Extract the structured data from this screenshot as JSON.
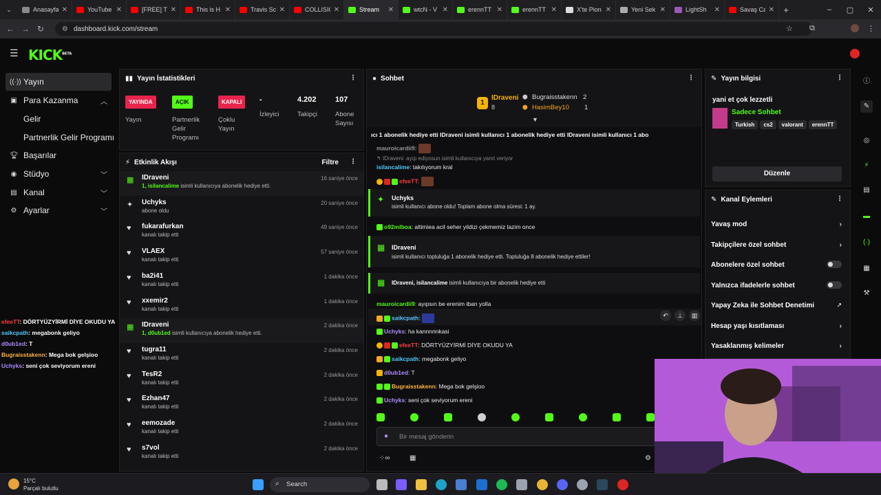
{
  "browser": {
    "tabs": [
      {
        "label": "Anasayfa",
        "color": "#888888"
      },
      {
        "label": "YouTube",
        "color": "#ff0000"
      },
      {
        "label": "[FREE] TRAVIS",
        "color": "#ff0000"
      },
      {
        "label": "This is H",
        "color": "#ff0000"
      },
      {
        "label": "Travis Sc",
        "color": "#ff0000"
      },
      {
        "label": "COLLISION",
        "color": "#ff0000"
      },
      {
        "label": "Stream",
        "color": "#53fc18"
      },
      {
        "label": "wtcN - V",
        "color": "#53fc18"
      },
      {
        "label": "erennTT",
        "color": "#53fc18"
      },
      {
        "label": "erennTT",
        "color": "#53fc18"
      },
      {
        "label": "X'te Pion",
        "color": "#dddddd"
      },
      {
        "label": "Yeni Sek",
        "color": "#aaaaaa"
      },
      {
        "label": "LightSh",
        "color": "#9b59b6"
      },
      {
        "label": "Savaş Ca",
        "color": "#ff0000"
      }
    ],
    "url": "dashboard.kick.com/stream"
  },
  "brand": {
    "logo": "KICK",
    "beta": "BETA",
    "accent": "#53fc18"
  },
  "nav": {
    "yayin": "Yayın",
    "para": "Para Kazanma",
    "gelir": "Gelir",
    "partner": "Partnerlik Gelir Programı",
    "basarilar": "Başarılar",
    "studyo": "Stüdyo",
    "kanal": "Kanal",
    "ayarlar": "Ayarlar"
  },
  "overlay_chat": [
    {
      "user": "efeeTT",
      "text": ": DÖRTYÜZYİRMİ DİYE OKUDU YA",
      "color": "#ff3b3b"
    },
    {
      "user": "saikcpath",
      "text": ": megabonk geliyo",
      "color": "#53c8ff"
    },
    {
      "user": "d0ub1ed",
      "text": ": T",
      "color": "#b18cff"
    },
    {
      "user": "Bugraisstakenn",
      "text": ": Mega bok gelşioo",
      "color": "#ffb340"
    },
    {
      "user": "Uchyks",
      "text": ": seni çok seviyorum ereni",
      "color": "#b18cff"
    }
  ],
  "stats": {
    "title": "Yayın İstatistikleri",
    "yayin_badge": "YAYINDA",
    "yayin_label": "Yayın",
    "partner_badge": "AÇIK",
    "partner_label": "Partnerlik Gelir Programı",
    "coklu_badge": "KAPALI",
    "coklu_label": "Çoklu Yayın",
    "izleyici_val": "-",
    "izleyici_label": "İzleyici",
    "takipci_val": "4.202",
    "takipci_label": "Takipçi",
    "abone_val": "107",
    "abone_label": "Abone Sayısı"
  },
  "activity": {
    "title": "Etkinlik Akışı",
    "filter": "Filtre",
    "items": [
      {
        "name": "IDraveni",
        "desc_hl": "1, isilancalime",
        "desc": " isimli kullanıcıya abonelik hediye etti.",
        "time": "16 saniye önce",
        "icon": "gift"
      },
      {
        "name": "Uchyks",
        "desc_hl": "",
        "desc": "abone oldu",
        "time": "20 saniye önce",
        "icon": "star"
      },
      {
        "name": "fukarafurkan",
        "desc_hl": "",
        "desc": "kanalı takip etti",
        "time": "49 saniye önce",
        "icon": "heart"
      },
      {
        "name": "VLAEX",
        "desc_hl": "",
        "desc": "kanalı takip etti",
        "time": "57 saniye önce",
        "icon": "heart"
      },
      {
        "name": "ba2i41",
        "desc_hl": "",
        "desc": "kanalı takip etti",
        "time": "1 dakika önce",
        "icon": "heart"
      },
      {
        "name": "xxemir2",
        "desc_hl": "",
        "desc": "kanalı takip etti",
        "time": "1 dakika önce",
        "icon": "heart"
      },
      {
        "name": "IDraveni",
        "desc_hl": "1, d0ub1ed",
        "desc": " isimli kullanıcıya abonelik hediye etti.",
        "time": "2 dakika önce",
        "icon": "gift"
      },
      {
        "name": "tugra11",
        "desc_hl": "",
        "desc": "kanalı takip etti",
        "time": "2 dakika önce",
        "icon": "heart"
      },
      {
        "name": "TesR2",
        "desc_hl": "",
        "desc": "kanalı takip etti",
        "time": "2 dakika önce",
        "icon": "heart"
      },
      {
        "name": "Ezhan47",
        "desc_hl": "",
        "desc": "kanalı takip etti",
        "time": "2 dakika önce",
        "icon": "heart"
      },
      {
        "name": "eemozade",
        "desc_hl": "",
        "desc": "kanalı takip etti",
        "time": "2 dakika önce",
        "icon": "heart"
      },
      {
        "name": "s7vol",
        "desc_hl": "",
        "desc": "kanalı takip etti",
        "time": "2 dakika önce",
        "icon": "heart"
      }
    ]
  },
  "chat": {
    "title": "Sohbet",
    "leader_rank": "1",
    "leader_name": "IDraveni",
    "leader_count": "8",
    "top2_name": "Bugraisstakenn",
    "top2_count": "2",
    "top3_name": "HasimBey10",
    "top3_count": "1",
    "ticker": "ıcı 1 abonelik hediye etti   IDraveni isimli kullanıcı 1 abonelik hediye etti   IDraveni isimli kullanıcı 1 abo",
    "cutoff_user": "mauroicardii9:",
    "reply_note": "IDraveni: ayıp ediyosun isimli kullanıcıya yanıt veriyor",
    "m1_user": "isilancalime",
    "m1_text": ": takılıyorum kral",
    "m2_user": "efeeTT:",
    "sys1_name": "Uchyks",
    "sys1_text": "isimli kullanıcı abone oldu! Toplam abone olma süresi: 1 ay.",
    "m3_user": "o92mlboa",
    "m3_text": ": altimiea acil seher yildizi çekmemiz lazim once",
    "sys2_name": "IDraveni",
    "sys2_text": "isimli kullanıcı topluluğa 1 abonelik hediye etti. Topluluğa 8 abonelik hediye ettiler!",
    "sys3_name": "IDraveni, isilancalime",
    "sys3_text": " isimli kullanıcıya bir abonelik hediye etti",
    "m4_user": "mauroicardii9",
    "m4_text": ": ayıpsın be erenim iban yolla",
    "m5_user": "saikcpath:",
    "m6_user": "Uchyks",
    "m6_text": ": ha kannnnnkasi",
    "m7_user": "efeeTT",
    "m7_text": ": DÖRTYÜZYİRMİ DİYE OKUDU YA",
    "m8_user": "saikcpath",
    "m8_text": ": megabonk geliyo",
    "m9_user": "d0ub1ed",
    "m9_text": ": T",
    "m10_user": "Bugraisstakenn",
    "m10_text": ": Mega bok gelşioo",
    "m11_user": "Uchyks",
    "m11_text": ": seni çok seviyorum ereni",
    "placeholder": "Bir mesaj gönderin"
  },
  "info": {
    "title": "Yayın bilgisi",
    "stream_title": "yani et çok lezzetli",
    "category": "Sadece Sohbet",
    "tags": [
      "Turkish",
      "cs2",
      "valorant",
      "erennTT"
    ],
    "edit": "Düzenle"
  },
  "actions": {
    "title": "Kanal Eylemleri",
    "items": [
      "Yavaş mod",
      "Takipçilere özel sohbet",
      "Abonelere özel sohbet",
      "Yalnızca ifadelerle sohbet",
      "Yapay Zeka ile Sohbet Denetimi",
      "Hesap yaşı kısıtlaması",
      "Yasaklanmış kelimeler"
    ]
  },
  "taskbar": {
    "temp": "15°C",
    "weather": "Parçalı bulutlu",
    "search": "Search"
  }
}
